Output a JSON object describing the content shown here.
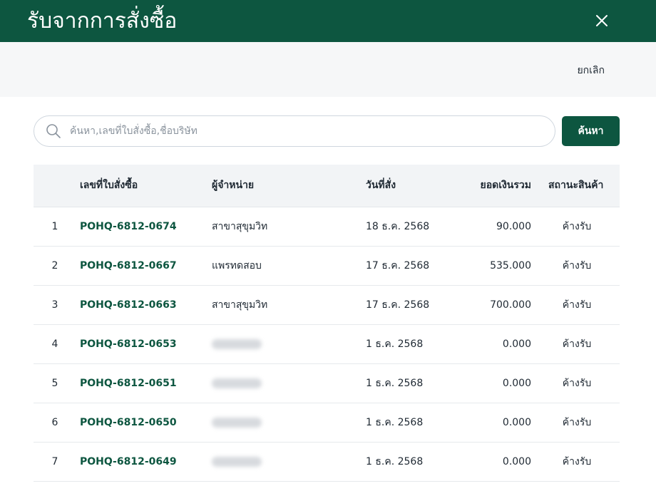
{
  "dialog": {
    "title": "รับจากการสั่งซื้อ",
    "cancel_label": "ยกเลิก"
  },
  "search": {
    "placeholder": "ค้นหา,เลขที่ใบสั่งซื้อ,ชื่อบริษัท",
    "value": "",
    "button_label": "ค้นหา"
  },
  "table": {
    "headers": {
      "po_number": "เลขที่ใบสั่งซื้อ",
      "vendor": "ผู้จำหน่าย",
      "order_date": "วันที่สั่ง",
      "total": "ยอดเงินรวม",
      "status": "สถานะสินค้า"
    },
    "rows": [
      {
        "no": "1",
        "po_number": "POHQ-6812-0674",
        "vendor": "สาขาสุขุมวิท",
        "order_date": "18 ธ.ค. 2568",
        "total": "90.000",
        "status": "ค้างรับ"
      },
      {
        "no": "2",
        "po_number": "POHQ-6812-0667",
        "vendor": "แพรทดสอบ",
        "order_date": "17 ธ.ค. 2568",
        "total": "535.000",
        "status": "ค้างรับ"
      },
      {
        "no": "3",
        "po_number": "POHQ-6812-0663",
        "vendor": "สาขาสุขุมวิท",
        "order_date": "17 ธ.ค. 2568",
        "total": "700.000",
        "status": "ค้างรับ"
      },
      {
        "no": "4",
        "po_number": "POHQ-6812-0653",
        "vendor": "",
        "order_date": "1 ธ.ค. 2568",
        "total": "0.000",
        "status": "ค้างรับ"
      },
      {
        "no": "5",
        "po_number": "POHQ-6812-0651",
        "vendor": "",
        "order_date": "1 ธ.ค. 2568",
        "total": "0.000",
        "status": "ค้างรับ"
      },
      {
        "no": "6",
        "po_number": "POHQ-6812-0650",
        "vendor": "",
        "order_date": "1 ธ.ค. 2568",
        "total": "0.000",
        "status": "ค้างรับ"
      },
      {
        "no": "7",
        "po_number": "POHQ-6812-0649",
        "vendor": "",
        "order_date": "1 ธ.ค. 2568",
        "total": "0.000",
        "status": "ค้างรับ"
      }
    ]
  },
  "icons": {
    "close": "close-icon",
    "search": "search-icon"
  },
  "colors": {
    "brand": "#0d5640",
    "toolbar_bg": "#f6f7f8",
    "table_header_bg": "#f2f4f6"
  }
}
